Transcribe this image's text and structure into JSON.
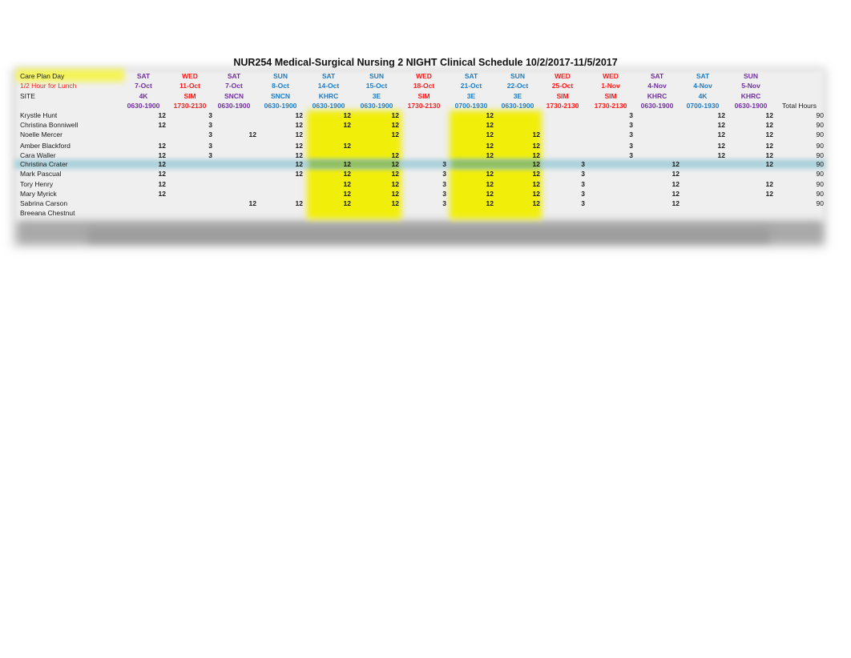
{
  "title": "NUR254 Medical-Surgical Nursing 2 NIGHT Clinical Schedule 10/2/2017-11/5/2017",
  "row_labels": {
    "care_plan_day": "Care Plan Day",
    "lunch": "1/2 Hour for Lunch",
    "site": "SITE"
  },
  "total_hours_label": "Total Hours",
  "colors": {
    "purple": "#7030a0",
    "red": "#ff1a1a",
    "blue": "#1f7bc4",
    "highlight_yellow": "#f1ee0a",
    "row_highlight_blue": "#a9d0da"
  },
  "columns": [
    {
      "day": "SAT",
      "date": "7-Oct",
      "site": "4K",
      "time": "0630-1900",
      "color": "purple"
    },
    {
      "day": "WED",
      "date": "11-Oct",
      "site": "SIM",
      "time": "1730-2130",
      "color": "red"
    },
    {
      "day": "SAT",
      "date": "7-Oct",
      "site": "SNCN",
      "time": "0630-1900",
      "color": "purple"
    },
    {
      "day": "SUN",
      "date": "8-Oct",
      "site": "SNCN",
      "time": "0630-1900",
      "color": "blue"
    },
    {
      "day": "SAT",
      "date": "14-Oct",
      "site": "KHRC",
      "time": "0630-1900",
      "color": "blue"
    },
    {
      "day": "SUN",
      "date": "15-Oct",
      "site": "3E",
      "time": "0630-1900",
      "color": "blue"
    },
    {
      "day": "WED",
      "date": "18-Oct",
      "site": "SIM",
      "time": "1730-2130",
      "color": "red"
    },
    {
      "day": "SAT",
      "date": "21-Oct",
      "site": "3E",
      "time": "0700-1930",
      "color": "blue"
    },
    {
      "day": "SUN",
      "date": "22-Oct",
      "site": "3E",
      "time": "0630-1900",
      "color": "blue"
    },
    {
      "day": "WED",
      "date": "25-Oct",
      "site": "SIM",
      "time": "1730-2130",
      "color": "red"
    },
    {
      "day": "WED",
      "date": "1-Nov",
      "site": "SIM",
      "time": "1730-2130",
      "color": "red"
    },
    {
      "day": "SAT",
      "date": "4-Nov",
      "site": "KHRC",
      "time": "0630-1900",
      "color": "purple"
    },
    {
      "day": "SAT",
      "date": "4-Nov",
      "site": "4K",
      "time": "0700-1930",
      "color": "blue"
    },
    {
      "day": "SUN",
      "date": "5-Nov",
      "site": "KHRC",
      "time": "0630-1900",
      "color": "purple"
    }
  ],
  "students": [
    {
      "name": "Krystle Hunt",
      "hours": [
        "12",
        "3",
        "",
        "12",
        "12",
        "12",
        "",
        "12",
        "",
        "",
        "3",
        "",
        "12",
        "12"
      ],
      "total": "90"
    },
    {
      "name": "Christina Bonniwell",
      "hours": [
        "12",
        "3",
        "",
        "12",
        "12",
        "12",
        "",
        "12",
        "",
        "",
        "3",
        "",
        "12",
        "12"
      ],
      "total": "90"
    },
    {
      "name": "Noelle Mercer",
      "hours": [
        "",
        "3",
        "12",
        "12",
        "",
        "12",
        "",
        "12",
        "12",
        "",
        "3",
        "",
        "12",
        "12"
      ],
      "total": "90"
    },
    {
      "name": "Amber Blackford",
      "hours": [
        "12",
        "3",
        "",
        "12",
        "12",
        "",
        "",
        "12",
        "12",
        "",
        "3",
        "",
        "12",
        "12"
      ],
      "total": "90"
    },
    {
      "name": "Cara Waller",
      "hours": [
        "12",
        "3",
        "",
        "12",
        "",
        "12",
        "",
        "12",
        "12",
        "",
        "3",
        "",
        "12",
        "12"
      ],
      "total": "90"
    },
    {
      "name": "Christina Crater",
      "hours": [
        "12",
        "",
        "",
        "12",
        "12",
        "12",
        "3",
        "",
        "12",
        "3",
        "",
        "12",
        "",
        "12"
      ],
      "total": "90"
    },
    {
      "name": "Mark Pascual",
      "hours": [
        "12",
        "",
        "",
        "12",
        "12",
        "12",
        "3",
        "12",
        "12",
        "3",
        "",
        "12",
        "",
        ""
      ],
      "total": "90"
    },
    {
      "name": "Tory Henry",
      "hours": [
        "12",
        "",
        "",
        "",
        "12",
        "12",
        "3",
        "12",
        "12",
        "3",
        "",
        "12",
        "",
        "12"
      ],
      "total": "90"
    },
    {
      "name": "Mary Myrick",
      "hours": [
        "12",
        "",
        "",
        "",
        "12",
        "12",
        "3",
        "12",
        "12",
        "3",
        "",
        "12",
        "",
        "12"
      ],
      "total": "90"
    },
    {
      "name": "Sabrina Carson",
      "hours": [
        "",
        "",
        "12",
        "12",
        "12",
        "12",
        "3",
        "12",
        "12",
        "3",
        "",
        "12",
        "",
        ""
      ],
      "total": "90"
    },
    {
      "name": "Breeana Chestnut",
      "hours": [
        "",
        "",
        "",
        "",
        "",
        "",
        "",
        "",
        "",
        "",
        "",
        "",
        "",
        ""
      ],
      "total": ""
    }
  ]
}
